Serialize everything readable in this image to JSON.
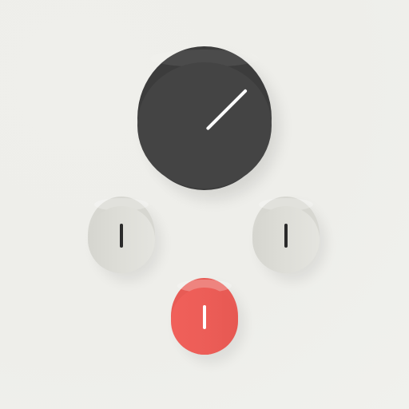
{
  "controls": {
    "main_knob": {
      "pointer_angle_deg": 45,
      "color": "#444444",
      "pointer_color": "#ffffff"
    },
    "left_knob": {
      "pointer_angle_deg": 0,
      "color": "#d9d9d3",
      "pointer_color": "#2a2a2a"
    },
    "right_knob": {
      "pointer_angle_deg": 0,
      "color": "#d9d9d3",
      "pointer_color": "#2a2a2a"
    },
    "red_knob": {
      "pointer_angle_deg": 0,
      "color": "#ec5d57",
      "pointer_color": "#ffffff"
    }
  }
}
